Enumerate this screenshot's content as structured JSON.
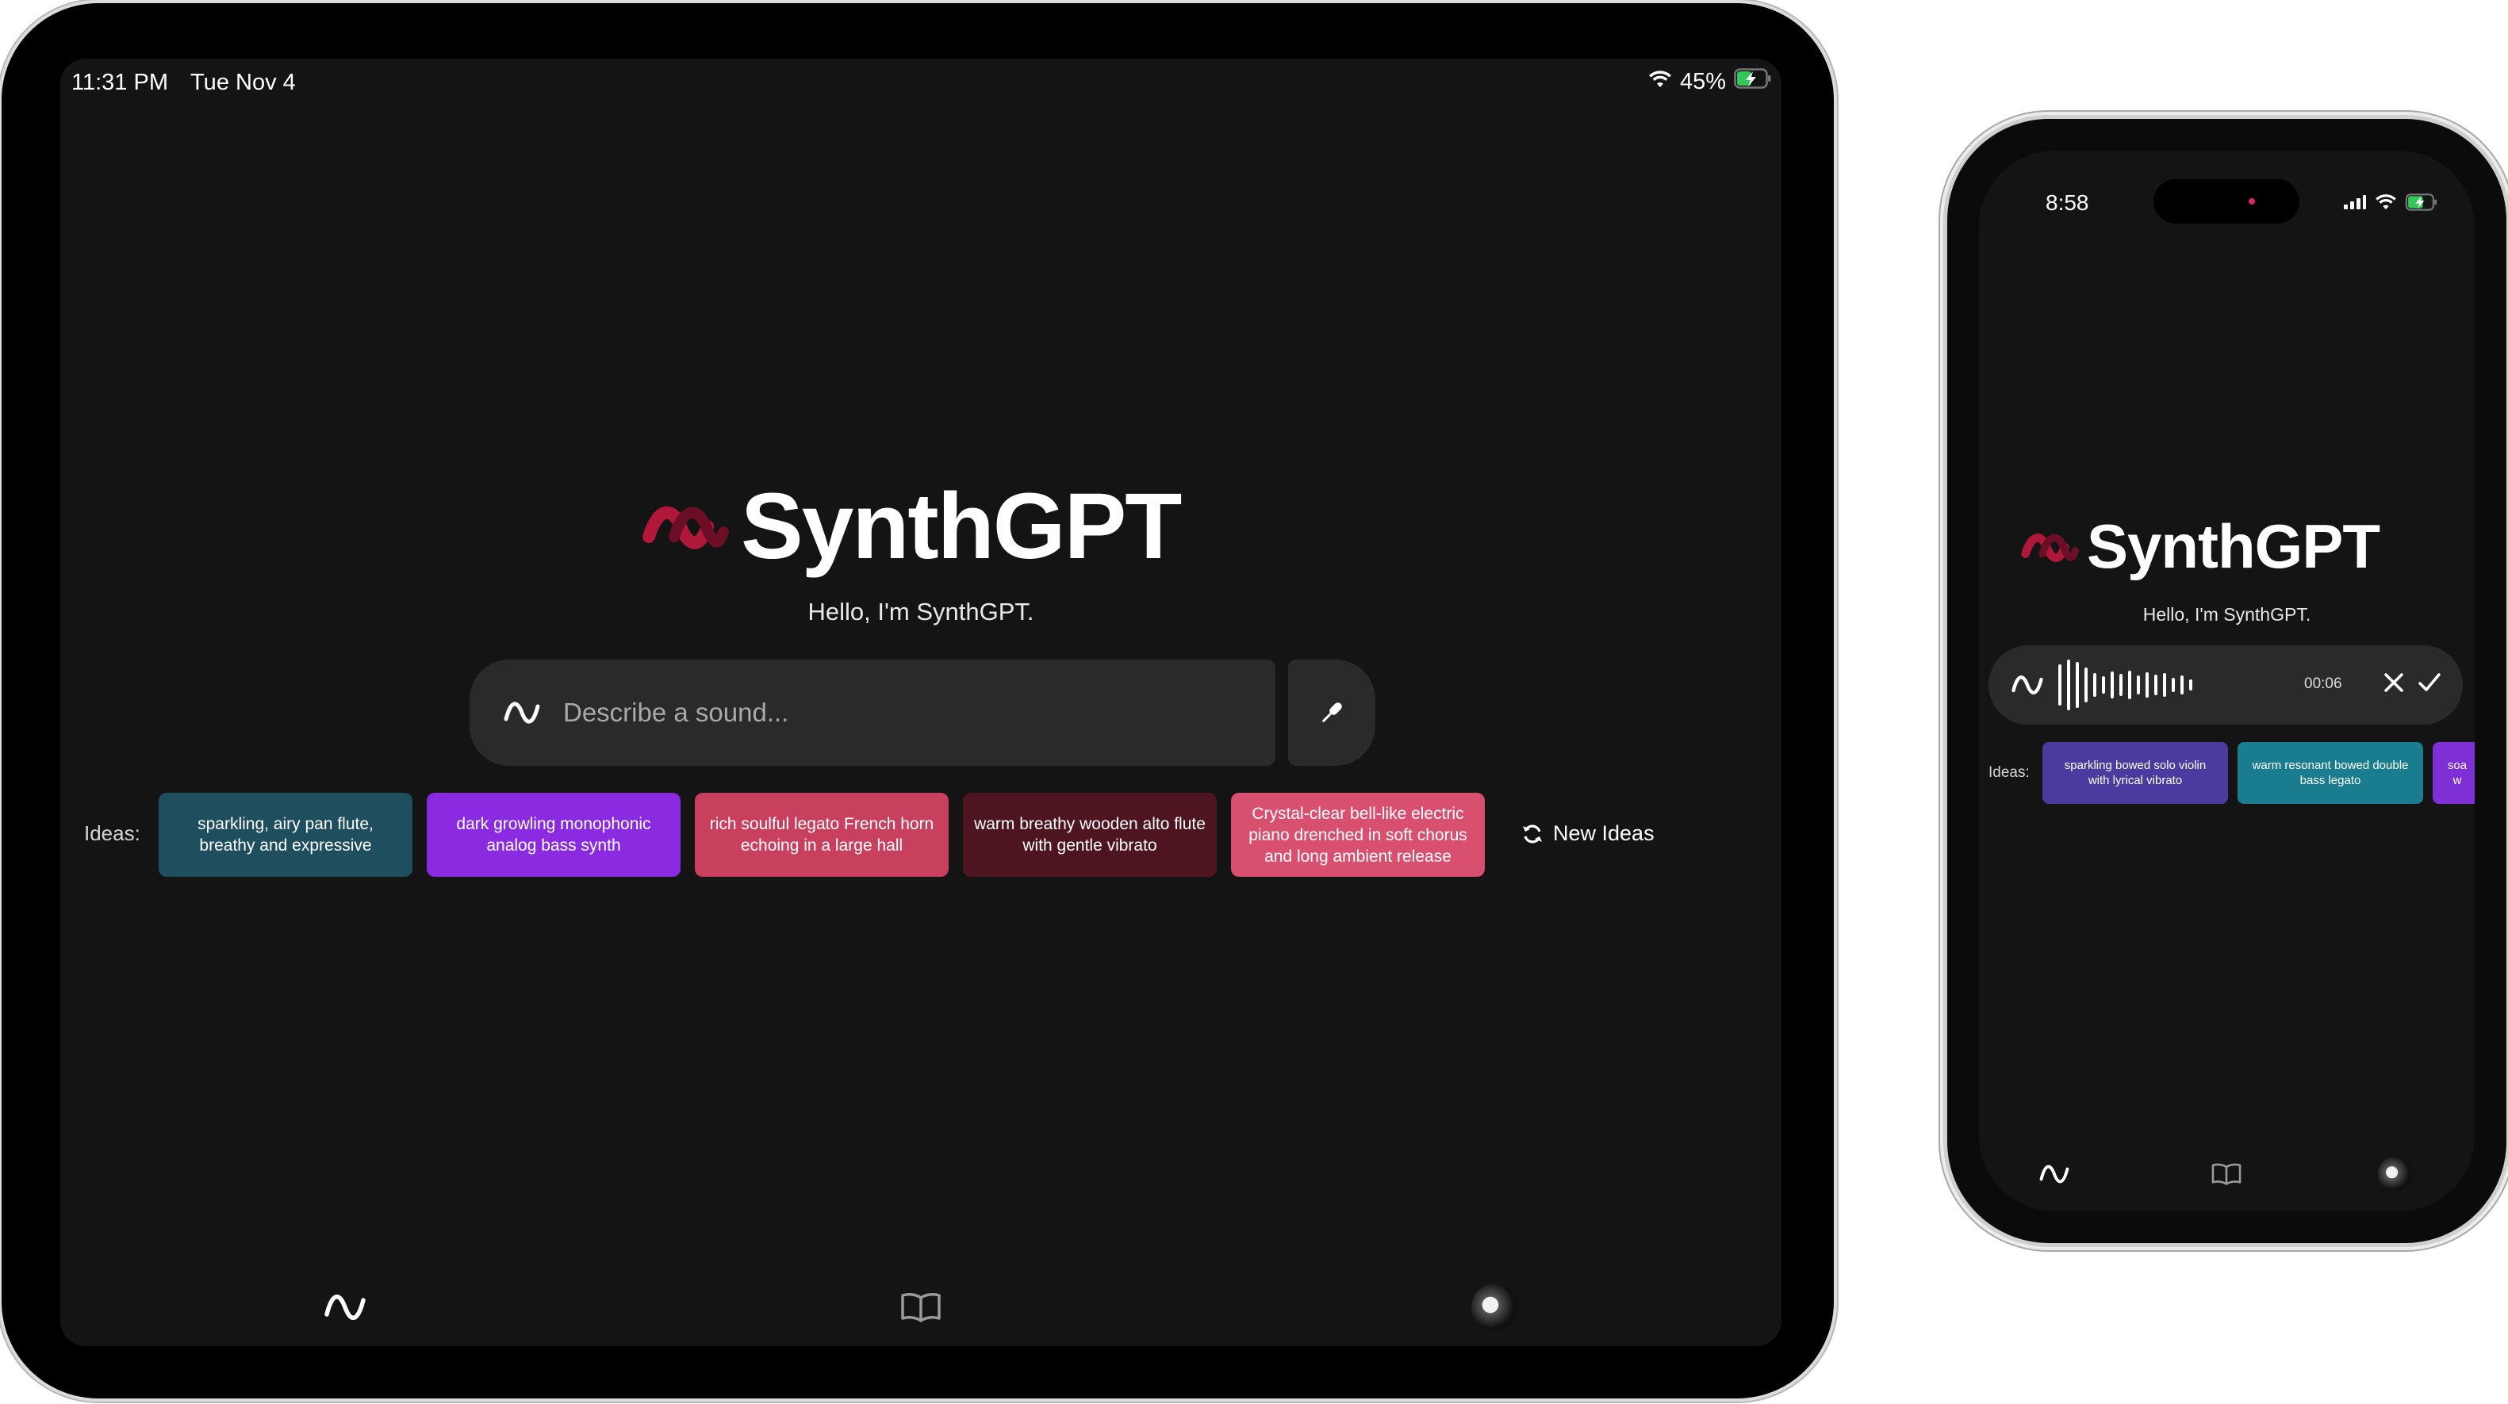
{
  "tablet": {
    "status": {
      "time": "11:31 PM",
      "date": "Tue Nov 4",
      "battery": "45%"
    },
    "brand": {
      "name": "SynthGPT"
    },
    "greeting": "Hello, I'm SynthGPT.",
    "search": {
      "placeholder": "Describe a sound..."
    },
    "ideas": {
      "label": "Ideas:",
      "items": [
        {
          "text": "sparkling, airy pan flute, breathy and expressive",
          "color": "#1f4e5f"
        },
        {
          "text": "dark growling monophonic analog bass synth",
          "color": "#8a2be2"
        },
        {
          "text": "rich soulful legato French horn echoing in a large hall",
          "color": "#c9405f"
        },
        {
          "text": "warm breathy wooden alto flute with gentle vibrato",
          "color": "#4e1420"
        },
        {
          "text": "Crystal-clear bell-like electric piano drenched in soft chorus and long ambient release",
          "color": "#d94f6f"
        }
      ],
      "new_ideas_label": "New Ideas"
    },
    "nav": [
      "synth-icon",
      "library-icon",
      "profile-avatar"
    ]
  },
  "phone": {
    "status": {
      "time": "8:58"
    },
    "brand": {
      "name": "SynthGPT"
    },
    "greeting": "Hello, I'm SynthGPT.",
    "recording": {
      "elapsed": "00:06"
    },
    "ideas": {
      "label": "Ideas:",
      "items": [
        {
          "text": "sparkling bowed solo violin with lyrical vibrato",
          "color": "#4b3aa0"
        },
        {
          "text": "warm resonant bowed double bass legato",
          "color": "#1a7d8f"
        },
        {
          "text": "soa w",
          "color": "#7e2fd6"
        }
      ]
    }
  },
  "colors": {
    "background": "#141414",
    "surface": "#2a2a2a",
    "logo_accent": "#b0183a",
    "battery_charging": "#34c759"
  }
}
